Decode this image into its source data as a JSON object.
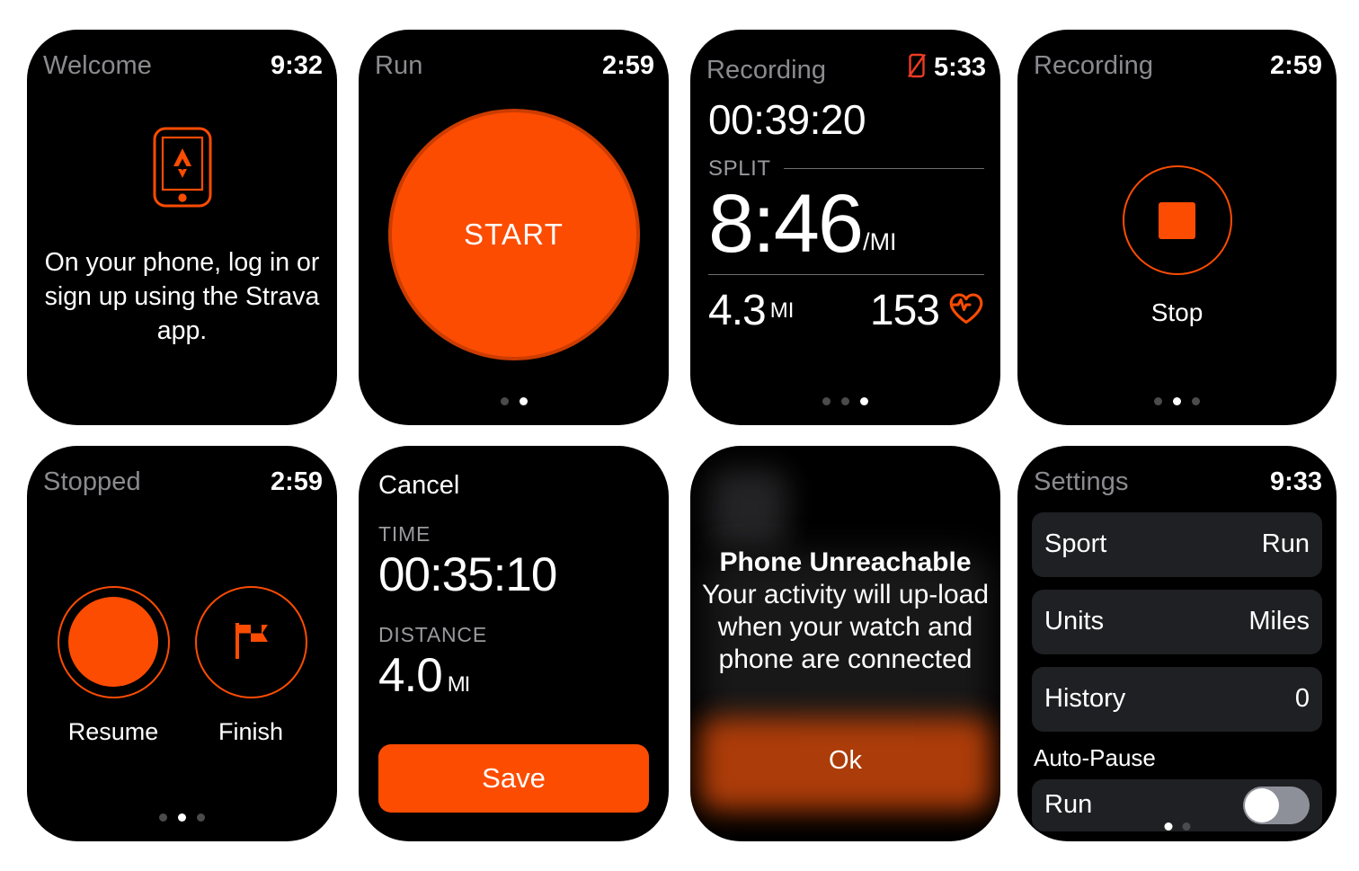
{
  "colors": {
    "strava_orange": "#fc4c02",
    "orange_dark_ring": "#cc3c00",
    "header_gray": "#8b8b8f",
    "row_bg": "#1e2023",
    "screen_bg": "#000000",
    "toggle_off": "#8e9099"
  },
  "screens": [
    {
      "id": "welcome",
      "header": {
        "title": "Welcome",
        "time": "9:32"
      },
      "icon": "phone-with-strava-logo-icon",
      "message": "On your phone, log in or sign up using the Strava app."
    },
    {
      "id": "run-start",
      "header": {
        "title": "Run",
        "time": "2:59"
      },
      "start_label": "START",
      "dots": {
        "count": 2,
        "active": 1
      }
    },
    {
      "id": "recording-metrics",
      "header": {
        "title": "Recording",
        "time": "5:33",
        "status_icon": "phone-disconnected-icon"
      },
      "elapsed": "00:39:20",
      "split_label": "SPLIT",
      "pace": "8:46",
      "pace_unit": "/MI",
      "distance": "4.3",
      "distance_unit": "MI",
      "heart_rate": "153",
      "heart_icon": "heart-pulse-icon",
      "dots": {
        "count": 3,
        "active": 2
      }
    },
    {
      "id": "recording-stop",
      "header": {
        "title": "Recording",
        "time": "2:59"
      },
      "stop_label": "Stop",
      "stop_icon": "stop-square-icon",
      "dots": {
        "count": 3,
        "active": 1
      }
    },
    {
      "id": "stopped",
      "header": {
        "title": "Stopped",
        "time": "2:59"
      },
      "actions": [
        {
          "label": "Resume",
          "icon": "resume-circle-icon"
        },
        {
          "label": "Finish",
          "icon": "checkered-flag-icon"
        }
      ],
      "dots": {
        "count": 3,
        "active": 1
      }
    },
    {
      "id": "save-activity",
      "cancel_label": "Cancel",
      "time_label": "TIME",
      "time_value": "00:35:10",
      "distance_label": "DISTANCE",
      "distance_value": "4.0",
      "distance_unit": "MI",
      "save_label": "Save"
    },
    {
      "id": "phone-unreachable-alert",
      "alert_title": "Phone Unreachable",
      "alert_body": "Your activity will up-load when your watch and phone are connected",
      "ok_label": "Ok"
    },
    {
      "id": "settings",
      "header": {
        "title": "Settings",
        "time": "9:33"
      },
      "rows": [
        {
          "key": "Sport",
          "value": "Run"
        },
        {
          "key": "Units",
          "value": "Miles"
        },
        {
          "key": "History",
          "value": "0"
        }
      ],
      "section_label": "Auto-Pause",
      "partial_row": {
        "key": "Run",
        "toggle": "off"
      },
      "dots": {
        "count": 2,
        "active": 0
      }
    }
  ]
}
